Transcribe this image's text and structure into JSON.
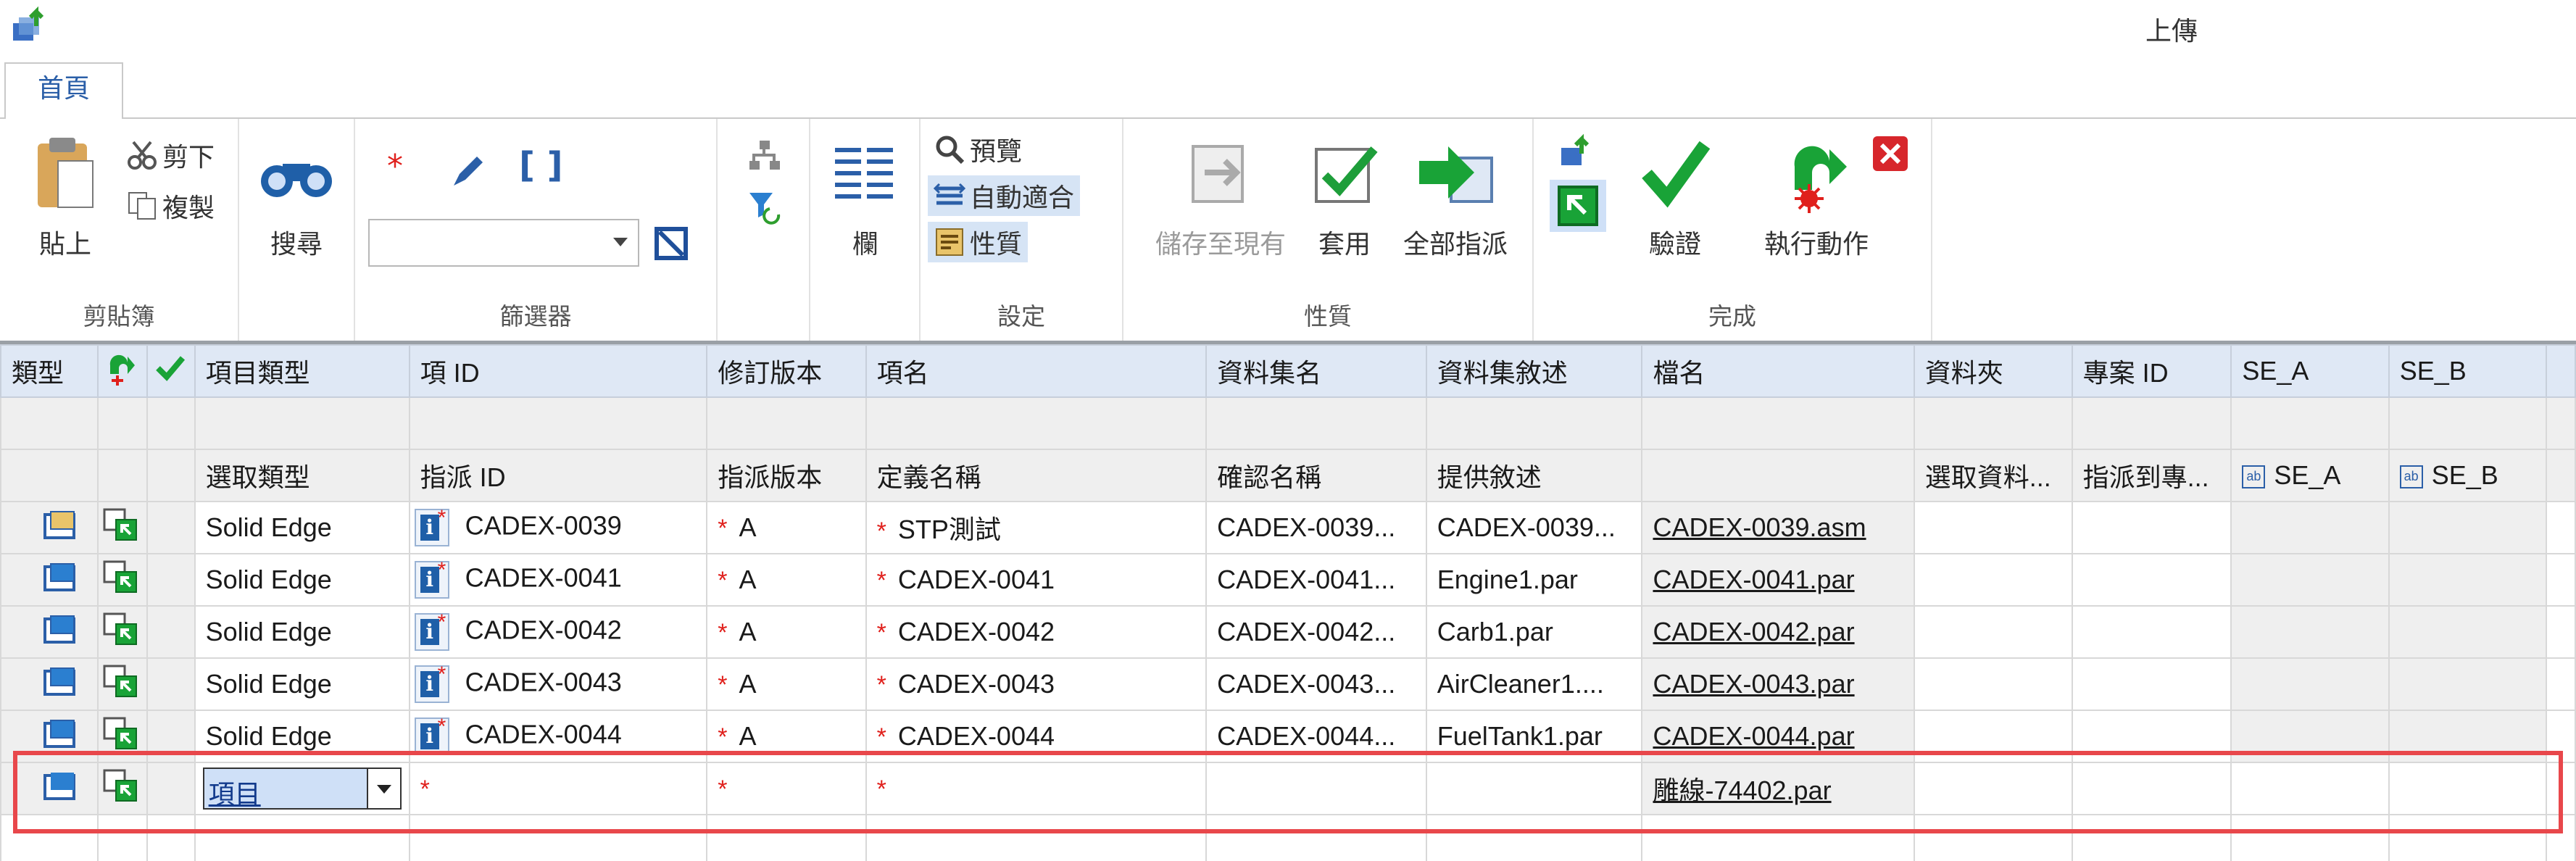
{
  "window": {
    "title": "上傳"
  },
  "tabs": [
    {
      "label": "首頁"
    }
  ],
  "ribbon": {
    "clipboard": {
      "paste": "貼上",
      "cut": "剪下",
      "copy": "複製",
      "group": "剪貼簿"
    },
    "search": {
      "label": "搜尋"
    },
    "filter": {
      "group": "篩選器",
      "combo_value": ""
    },
    "settings": {
      "columns": "欄",
      "preview": "預覽",
      "autofit": "自動適合",
      "properties": "性質",
      "group": "設定"
    },
    "props": {
      "save_existing": "儲存至現有",
      "apply": "套用",
      "assign_all": "全部指派",
      "group": "性質"
    },
    "finish": {
      "validate": "驗證",
      "run_action": "執行動作",
      "group": "完成"
    }
  },
  "grid": {
    "headers": [
      "類型",
      "",
      "",
      "項目類型",
      "項 ID",
      "修訂版本",
      "項名",
      "資料集名",
      "資料集敘述",
      "檔名",
      "資料夾",
      "專案 ID",
      "SE_A",
      "SE_B"
    ],
    "subheaders": [
      "",
      "",
      "",
      "選取類型",
      "指派 ID",
      "指派版本",
      "定義名稱",
      "確認名稱",
      "提供敘述",
      "",
      "選取資料...",
      "指派到專...",
      "SE_A",
      "SE_B"
    ],
    "rows": [
      {
        "item_type": "Solid Edge",
        "item_id": "CADEX-0039",
        "rev": "A",
        "name": "STP測試",
        "dataset_name": "CADEX-0039...",
        "dataset_desc": "CADEX-0039...",
        "filename": "CADEX-0039.asm"
      },
      {
        "item_type": "Solid Edge",
        "item_id": "CADEX-0041",
        "rev": "A",
        "name": "CADEX-0041",
        "dataset_name": "CADEX-0041...",
        "dataset_desc": "Engine1.par",
        "filename": "CADEX-0041.par"
      },
      {
        "item_type": "Solid Edge",
        "item_id": "CADEX-0042",
        "rev": "A",
        "name": "CADEX-0042",
        "dataset_name": "CADEX-0042...",
        "dataset_desc": "Carb1.par",
        "filename": "CADEX-0042.par"
      },
      {
        "item_type": "Solid Edge",
        "item_id": "CADEX-0043",
        "rev": "A",
        "name": "CADEX-0043",
        "dataset_name": "CADEX-0043...",
        "dataset_desc": "AirCleaner1....",
        "filename": "CADEX-0043.par"
      },
      {
        "item_type": "Solid Edge",
        "item_id": "CADEX-0044",
        "rev": "A",
        "name": "CADEX-0044",
        "dataset_name": "CADEX-0044...",
        "dataset_desc": "FuelTank1.par",
        "filename": "CADEX-0044.par"
      }
    ],
    "new_row": {
      "item_type": "項目",
      "filename": "雕線-74402.par"
    }
  },
  "colors": {
    "accent": "#2b5fa8",
    "header_bg": "#dfe8f5",
    "required": "#e0201c",
    "highlight": "#e8474b"
  }
}
